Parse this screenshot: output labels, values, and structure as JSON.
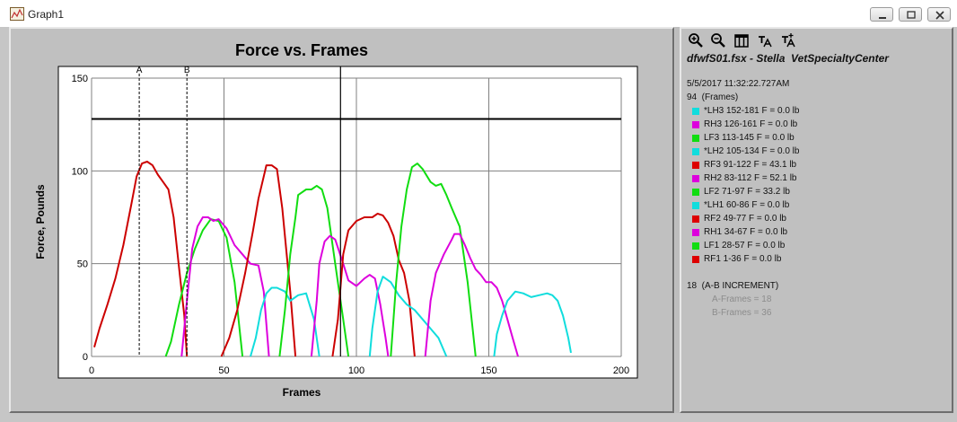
{
  "window": {
    "title": "Graph1"
  },
  "colors": {
    "red": "#cc0000",
    "magenta": "#dd00dd",
    "green": "#11dd11",
    "cyan": "#11dddd",
    "black": "#000000",
    "panel": "#c0c0c0"
  },
  "toolbar": {
    "icons": [
      "zoom-in-icon",
      "zoom-out-icon",
      "columns-icon",
      "text-tool-icon",
      "text-add-icon"
    ]
  },
  "info": {
    "file_line": "dfwfS01.fsx - Stella  VetSpecialtyCenter",
    "timestamp": "5/5/2017 11:32:22.727AM",
    "frames_line": "94  (Frames)",
    "increment_line": "18  (A-B INCREMENT)",
    "a_frames": "A-Frames = 18",
    "b_frames": "B-Frames = 36"
  },
  "legend": [
    {
      "label": "*LH3 152-181 F = 0.0 lb",
      "color": "#11dddd"
    },
    {
      "label": "RH3 126-161 F = 0.0 lb",
      "color": "#dd00dd"
    },
    {
      "label": "LF3 113-145 F = 0.0 lb",
      "color": "#11dd11"
    },
    {
      "label": "*LH2 105-134 F = 0.0 lb",
      "color": "#11dddd"
    },
    {
      "label": "RF3 91-122 F = 43.1 lb",
      "color": "#dd0000"
    },
    {
      "label": "RH2 83-112 F = 52.1 lb",
      "color": "#dd00dd"
    },
    {
      "label": "LF2 71-97 F = 33.2 lb",
      "color": "#11dd11"
    },
    {
      "label": "*LH1 60-86 F = 0.0 lb",
      "color": "#11dddd"
    },
    {
      "label": "RF2 49-77 F = 0.0 lb",
      "color": "#dd0000"
    },
    {
      "label": "RH1 34-67 F = 0.0 lb",
      "color": "#dd00dd"
    },
    {
      "label": "LF1 28-57 F = 0.0 lb",
      "color": "#11dd11"
    },
    {
      "label": "RF1 1-36 F = 0.0 lb",
      "color": "#dd0000"
    }
  ],
  "chart_data": {
    "type": "line",
    "title": "Force vs. Frames",
    "xlabel": "Frames",
    "ylabel": "Force, Pounds",
    "xlim": [
      0,
      200
    ],
    "ylim": [
      0,
      150
    ],
    "xticks": [
      0,
      50,
      100,
      150,
      200
    ],
    "yticks": [
      0,
      50,
      100,
      150
    ],
    "grid": true,
    "threshold": 128,
    "cursor_frame": 94,
    "markers": [
      {
        "label": "A",
        "x": 18
      },
      {
        "label": "B",
        "x": 36
      }
    ],
    "series": [
      {
        "color": "#cc0000",
        "points": [
          [
            1,
            5
          ],
          [
            3,
            15
          ],
          [
            6,
            28
          ],
          [
            9,
            42
          ],
          [
            12,
            60
          ],
          [
            15,
            82
          ],
          [
            17,
            97
          ],
          [
            19,
            104
          ],
          [
            21,
            105
          ],
          [
            23,
            103
          ],
          [
            25,
            98
          ],
          [
            27,
            94
          ],
          [
            29,
            90
          ],
          [
            31,
            75
          ],
          [
            33,
            48
          ],
          [
            35,
            22
          ],
          [
            36,
            0
          ]
        ]
      },
      {
        "color": "#11dd11",
        "points": [
          [
            28,
            0
          ],
          [
            30,
            8
          ],
          [
            33,
            28
          ],
          [
            36,
            45
          ],
          [
            39,
            58
          ],
          [
            42,
            68
          ],
          [
            45,
            74
          ],
          [
            48,
            73
          ],
          [
            51,
            64
          ],
          [
            54,
            40
          ],
          [
            57,
            0
          ]
        ]
      },
      {
        "color": "#dd00dd",
        "points": [
          [
            34,
            0
          ],
          [
            36,
            30
          ],
          [
            38,
            58
          ],
          [
            40,
            70
          ],
          [
            42,
            75
          ],
          [
            44,
            75
          ],
          [
            46,
            73
          ],
          [
            48,
            74
          ],
          [
            51,
            69
          ],
          [
            54,
            60
          ],
          [
            57,
            55
          ],
          [
            60,
            50
          ],
          [
            63,
            49
          ],
          [
            65,
            35
          ],
          [
            67,
            0
          ]
        ]
      },
      {
        "color": "#cc0000",
        "points": [
          [
            49,
            0
          ],
          [
            52,
            10
          ],
          [
            55,
            25
          ],
          [
            58,
            45
          ],
          [
            61,
            68
          ],
          [
            63,
            85
          ],
          [
            65,
            97
          ],
          [
            66,
            103
          ],
          [
            68,
            103
          ],
          [
            70,
            101
          ],
          [
            72,
            80
          ],
          [
            75,
            35
          ],
          [
            77,
            0
          ]
        ]
      },
      {
        "color": "#11dddd",
        "points": [
          [
            60,
            0
          ],
          [
            62,
            10
          ],
          [
            64,
            25
          ],
          [
            66,
            34
          ],
          [
            68,
            37
          ],
          [
            70,
            37
          ],
          [
            73,
            35
          ],
          [
            75,
            30
          ],
          [
            78,
            33
          ],
          [
            81,
            34
          ],
          [
            84,
            20
          ],
          [
            86,
            0
          ]
        ]
      },
      {
        "color": "#11dd11",
        "points": [
          [
            71,
            0
          ],
          [
            73,
            25
          ],
          [
            75,
            55
          ],
          [
            77,
            75
          ],
          [
            78,
            87
          ],
          [
            81,
            90
          ],
          [
            83,
            90
          ],
          [
            85,
            92
          ],
          [
            87,
            90
          ],
          [
            89,
            80
          ],
          [
            92,
            50
          ],
          [
            95,
            20
          ],
          [
            97,
            0
          ]
        ]
      },
      {
        "color": "#dd00dd",
        "points": [
          [
            83,
            0
          ],
          [
            85,
            30
          ],
          [
            86,
            50
          ],
          [
            88,
            62
          ],
          [
            90,
            65
          ],
          [
            92,
            63
          ],
          [
            95,
            50
          ],
          [
            97,
            41
          ],
          [
            100,
            38
          ],
          [
            103,
            42
          ],
          [
            105,
            44
          ],
          [
            107,
            42
          ],
          [
            109,
            28
          ],
          [
            111,
            10
          ],
          [
            112,
            0
          ]
        ]
      },
      {
        "color": "#cc0000",
        "points": [
          [
            91,
            0
          ],
          [
            93,
            20
          ],
          [
            95,
            55
          ],
          [
            97,
            68
          ],
          [
            100,
            73
          ],
          [
            103,
            75
          ],
          [
            106,
            75
          ],
          [
            108,
            77
          ],
          [
            110,
            76
          ],
          [
            112,
            72
          ],
          [
            114,
            65
          ],
          [
            116,
            52
          ],
          [
            118,
            45
          ],
          [
            120,
            30
          ],
          [
            122,
            0
          ]
        ]
      },
      {
        "color": "#11dddd",
        "points": [
          [
            105,
            0
          ],
          [
            106,
            15
          ],
          [
            108,
            35
          ],
          [
            110,
            43
          ],
          [
            113,
            40
          ],
          [
            116,
            33
          ],
          [
            119,
            28
          ],
          [
            122,
            25
          ],
          [
            125,
            20
          ],
          [
            128,
            15
          ],
          [
            131,
            10
          ],
          [
            134,
            0
          ]
        ]
      },
      {
        "color": "#11dd11",
        "points": [
          [
            113,
            0
          ],
          [
            115,
            40
          ],
          [
            117,
            70
          ],
          [
            119,
            90
          ],
          [
            121,
            102
          ],
          [
            123,
            104
          ],
          [
            125,
            101
          ],
          [
            128,
            94
          ],
          [
            130,
            92
          ],
          [
            132,
            93
          ],
          [
            134,
            87
          ],
          [
            136,
            80
          ],
          [
            139,
            70
          ],
          [
            142,
            40
          ],
          [
            145,
            0
          ]
        ]
      },
      {
        "color": "#dd00dd",
        "points": [
          [
            126,
            0
          ],
          [
            128,
            30
          ],
          [
            130,
            45
          ],
          [
            133,
            55
          ],
          [
            136,
            63
          ],
          [
            137,
            66
          ],
          [
            139,
            66
          ],
          [
            141,
            60
          ],
          [
            143,
            53
          ],
          [
            145,
            47
          ],
          [
            147,
            44
          ],
          [
            149,
            40
          ],
          [
            151,
            40
          ],
          [
            153,
            37
          ],
          [
            155,
            30
          ],
          [
            157,
            20
          ],
          [
            159,
            10
          ],
          [
            161,
            0
          ]
        ]
      },
      {
        "color": "#11dddd",
        "points": [
          [
            152,
            0
          ],
          [
            153,
            12
          ],
          [
            155,
            22
          ],
          [
            157,
            30
          ],
          [
            160,
            35
          ],
          [
            163,
            34
          ],
          [
            166,
            32
          ],
          [
            169,
            33
          ],
          [
            172,
            34
          ],
          [
            174,
            33
          ],
          [
            176,
            30
          ],
          [
            178,
            22
          ],
          [
            180,
            10
          ],
          [
            181,
            2
          ]
        ]
      }
    ]
  }
}
